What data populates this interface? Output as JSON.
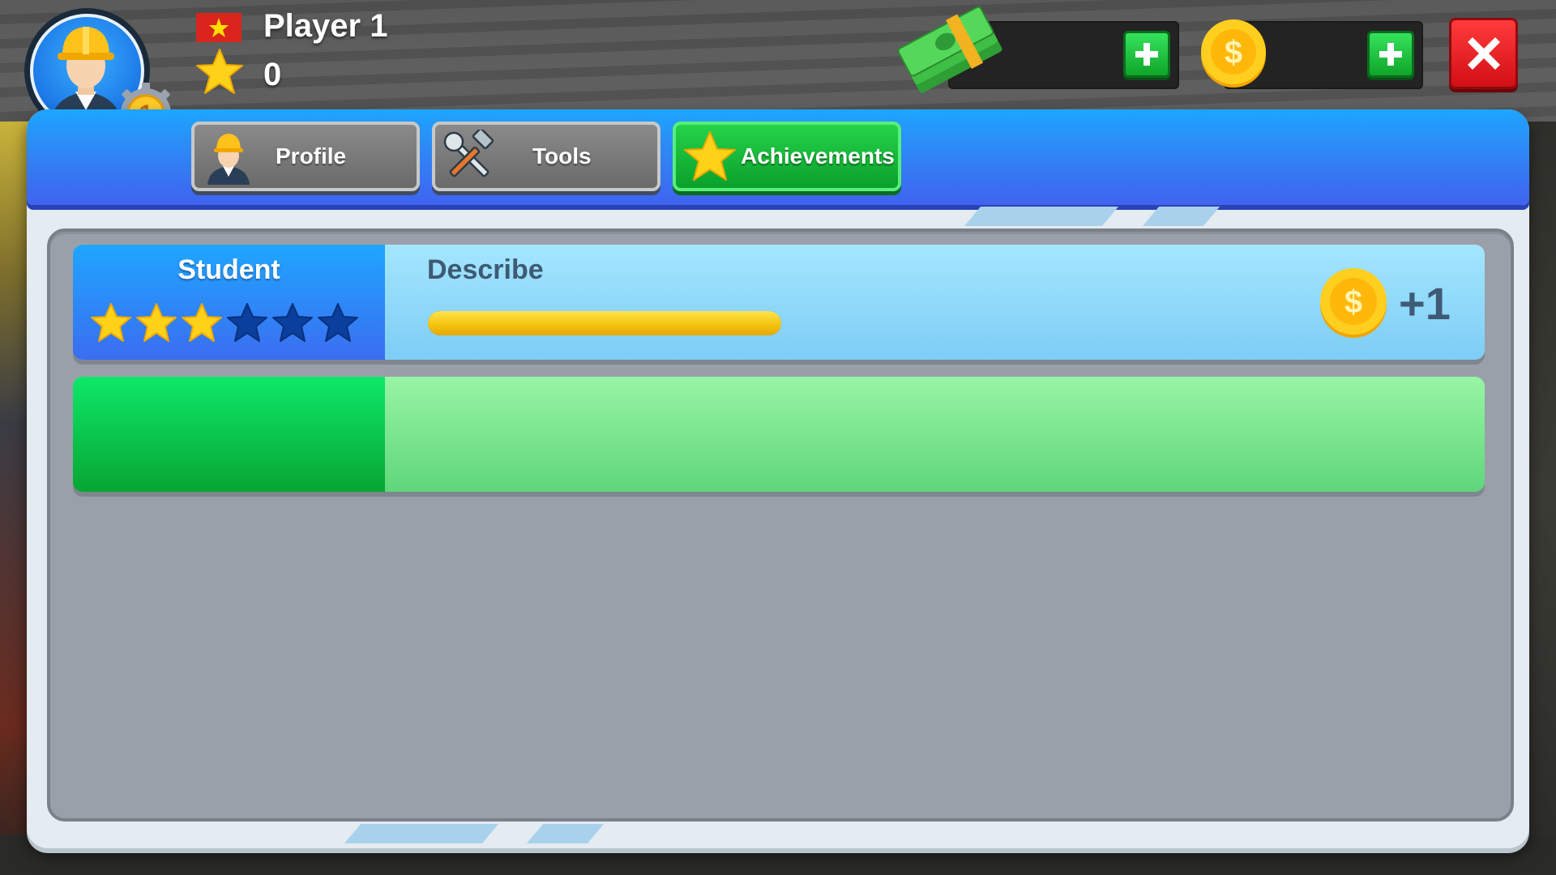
{
  "player": {
    "name": "Player 1",
    "level": "1",
    "stars": "0",
    "flag": "vietnam-flag"
  },
  "currency": {
    "cash_icon": "cash-stack-icon",
    "coin_icon": "gold-coin-icon",
    "add_label": "+"
  },
  "tabs": [
    {
      "label": "Profile",
      "icon": "worker-avatar-icon",
      "active": false
    },
    {
      "label": "Tools",
      "icon": "wrench-hammer-icon",
      "active": false
    },
    {
      "label": "Achievements",
      "icon": "star-icon",
      "active": true
    }
  ],
  "achievements": [
    {
      "title": "Student",
      "stars_filled": 3,
      "stars_total": 6,
      "description": "Describe",
      "progress": 1.0,
      "reward": "+1",
      "reward_icon": "gold-coin-icon"
    },
    {
      "title": "",
      "description": "",
      "reward": ""
    }
  ],
  "colors": {
    "header_blue": "#2f86f5",
    "active_tab_green": "#0aa02a",
    "close_red": "#d10f16",
    "star_yellow": "#ffd21a",
    "star_empty": "#0b3f9e"
  }
}
